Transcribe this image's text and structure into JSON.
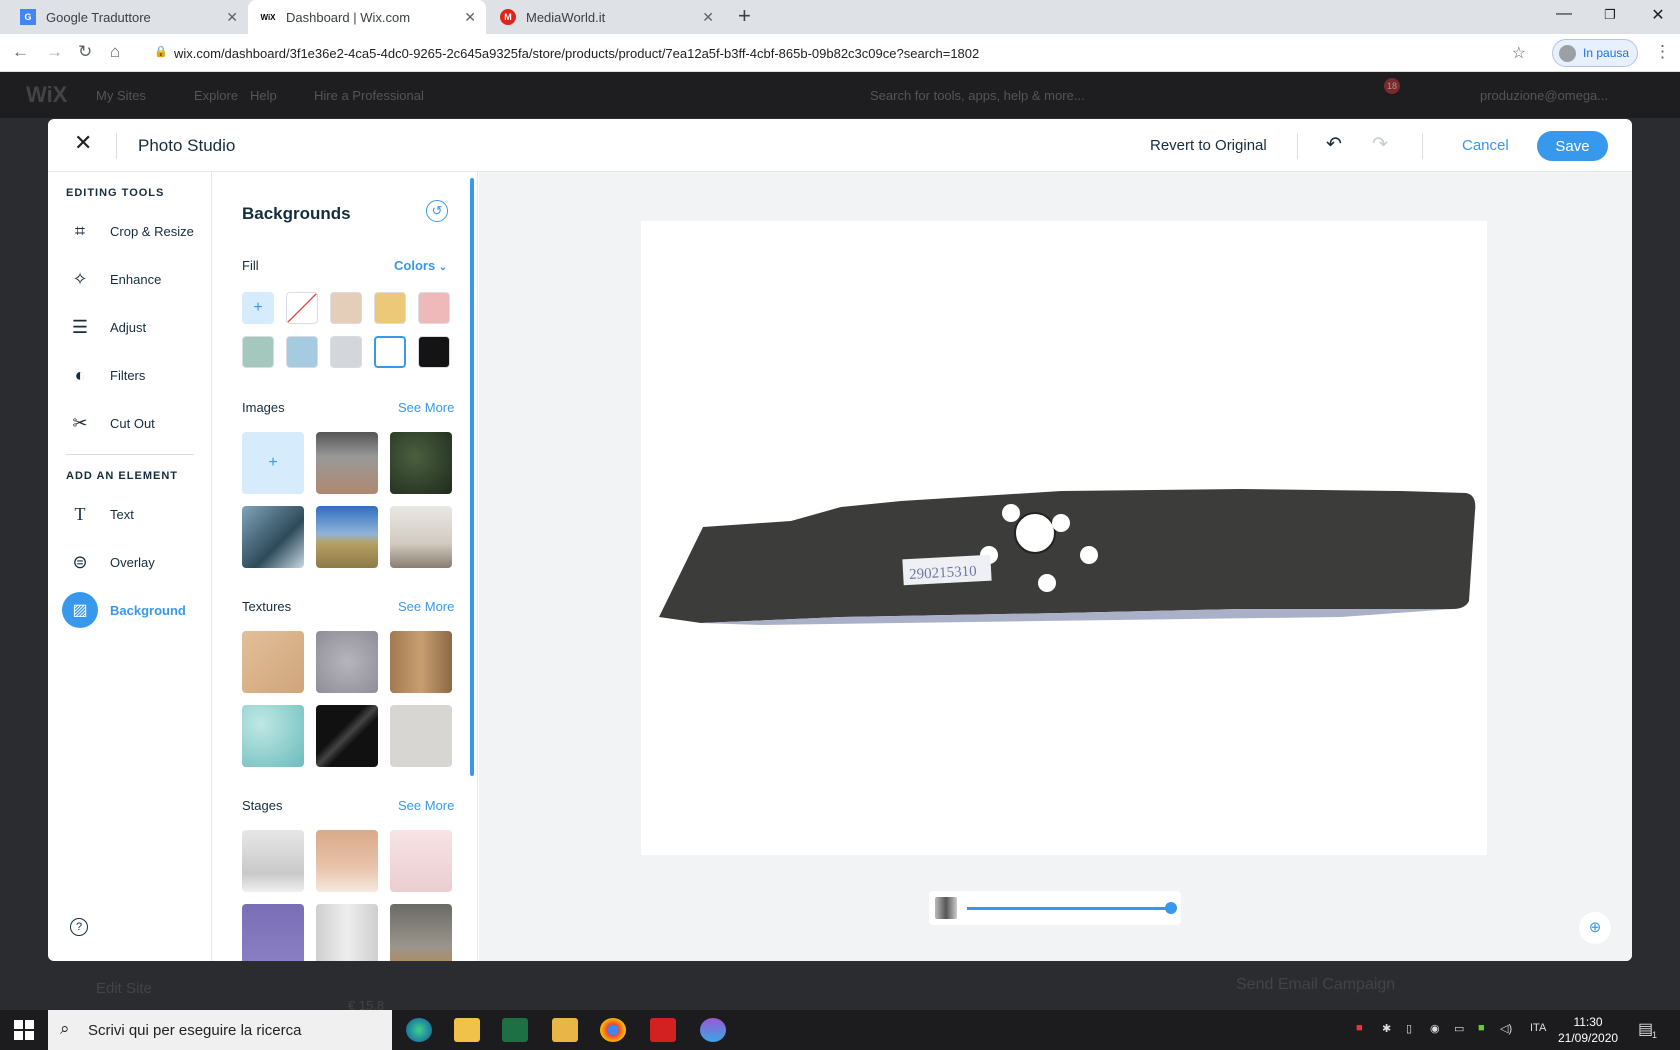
{
  "browser": {
    "tabs": [
      {
        "title": "Google Traduttore",
        "favicon": "G"
      },
      {
        "title": "Dashboard | Wix.com",
        "favicon": "WiX"
      },
      {
        "title": "MediaWorld.it",
        "favicon": "M"
      }
    ],
    "url": "wix.com/dashboard/3f1e36e2-4ca5-4dc0-9265-2c645a9325fa/store/products/product/7ea12a5f-b3ff-4cbf-865b-09b82c3c09ce?search=1802",
    "profile_label": "In pausa"
  },
  "wix_header": {
    "logo": "WiX",
    "nav": [
      "My Sites",
      "Explore",
      "Help",
      "Hire a Professional"
    ],
    "search_placeholder": "Search for tools, apps, help & more...",
    "notification_count": "18",
    "account": "produzione@omega..."
  },
  "background_page": {
    "edit_site": "Edit Site",
    "send_email": "Send Email Campaign",
    "price_field": "€ 15,8"
  },
  "modal": {
    "title": "Photo Studio",
    "revert_label": "Revert to Original",
    "cancel_label": "Cancel",
    "save_label": "Save"
  },
  "tools": {
    "editing_header": "EDITING TOOLS",
    "editing_items": [
      {
        "label": "Crop & Resize",
        "icon": "crop-icon"
      },
      {
        "label": "Enhance",
        "icon": "magic-wand-icon"
      },
      {
        "label": "Adjust",
        "icon": "sliders-icon"
      },
      {
        "label": "Filters",
        "icon": "filters-icon"
      },
      {
        "label": "Cut Out",
        "icon": "scissors-icon"
      }
    ],
    "element_header": "ADD AN ELEMENT",
    "element_items": [
      {
        "label": "Text",
        "icon": "text-icon"
      },
      {
        "label": "Overlay",
        "icon": "overlay-icon"
      },
      {
        "label": "Background",
        "icon": "background-icon"
      }
    ],
    "active": "Background"
  },
  "panel": {
    "title": "Backgrounds",
    "fill_label": "Fill",
    "fill_mode": "Colors",
    "swatches": [
      "add",
      "none",
      "#e4cdb9",
      "#ecc978",
      "#f0b9b9",
      "#a4c8bd",
      "#a5cbe0",
      "#d3d6da",
      "#ffffff",
      "#141414"
    ],
    "selected_swatch": "#ffffff",
    "images_label": "Images",
    "textures_label": "Textures",
    "stages_label": "Stages",
    "see_more": "See More"
  },
  "canvas": {
    "label_on_product": "290215310",
    "zoom_fraction": 1.0
  },
  "taskbar": {
    "search_placeholder": "Scrivi qui per eseguire la ricerca",
    "language": "ITA",
    "time": "11:30",
    "date": "21/09/2020",
    "notifications": "1"
  },
  "colors": {
    "accent": "#3899ec",
    "text": "#162d3d"
  }
}
